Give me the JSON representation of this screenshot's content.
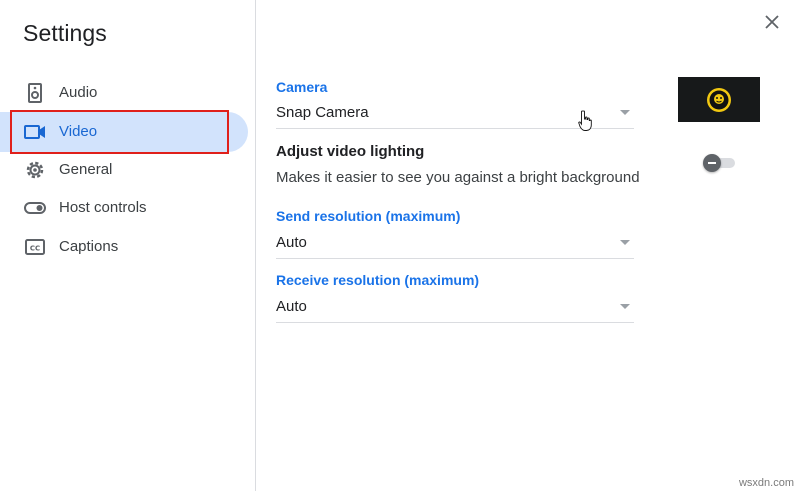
{
  "dialog": {
    "title": "Settings",
    "close_icon": "close-icon"
  },
  "sidebar": {
    "items": [
      {
        "label": "Audio",
        "icon": "speaker-icon",
        "active": false
      },
      {
        "label": "Video",
        "icon": "video-camera-icon",
        "active": true
      },
      {
        "label": "General",
        "icon": "gear-icon",
        "active": false
      },
      {
        "label": "Host controls",
        "icon": "toggle-icon",
        "active": false
      },
      {
        "label": "Captions",
        "icon": "closed-captions-icon",
        "active": false
      }
    ]
  },
  "video": {
    "camera": {
      "label": "Camera",
      "value": "Snap Camera"
    },
    "lighting": {
      "heading": "Adjust video lighting",
      "description": "Makes it easier to see you against a bright background",
      "enabled": false
    },
    "send_resolution": {
      "label": "Send resolution (maximum)",
      "value": "Auto"
    },
    "receive_resolution": {
      "label": "Receive resolution (maximum)",
      "value": "Auto"
    }
  },
  "colors": {
    "accent": "#1a73e8",
    "active_bg": "#d2e3fc",
    "annotation_red": "#e0201b"
  },
  "watermark": "wsxdn.com"
}
